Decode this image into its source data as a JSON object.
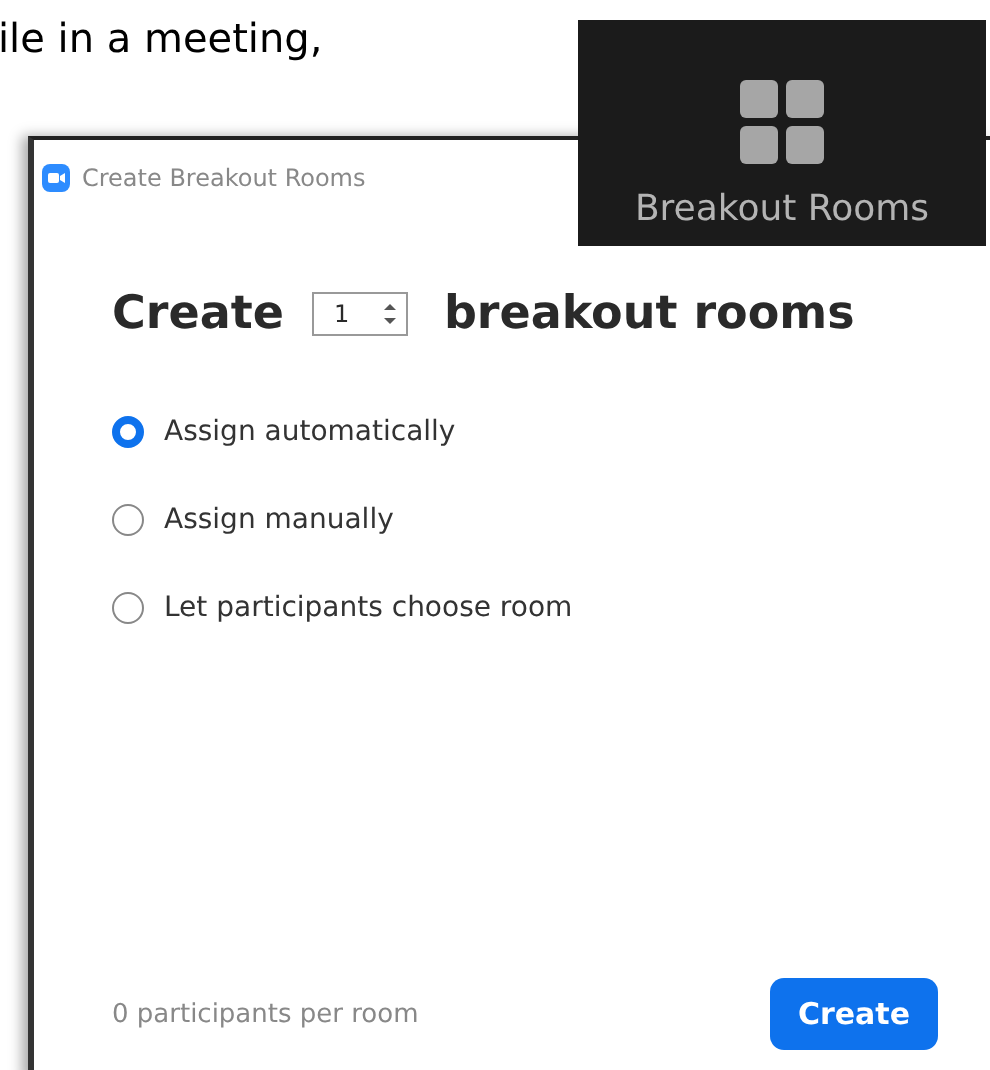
{
  "document_text": "ile in a meeting,",
  "toolbar_button": {
    "label": "Breakout Rooms"
  },
  "dialog": {
    "title": "Create Breakout Rooms",
    "heading_before": "Create",
    "room_count": "1",
    "heading_after": "breakout rooms",
    "options": [
      {
        "label": "Assign automatically",
        "selected": true
      },
      {
        "label": "Assign manually",
        "selected": false
      },
      {
        "label": "Let participants choose room",
        "selected": false
      }
    ],
    "summary": "0 participants per room",
    "create_button": "Create"
  }
}
